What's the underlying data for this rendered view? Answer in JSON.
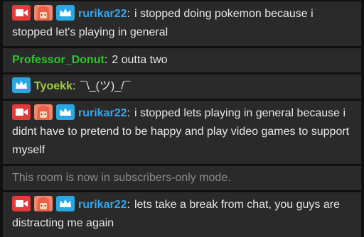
{
  "colors": {
    "background": "#111111",
    "message_bg": "#2a2a2a",
    "text": "#e6e6e6",
    "system_text": "#8a8a8a",
    "badge_red": "#e23b3b",
    "badge_orange": "#f0866c",
    "badge_blue": "#2aa7e3"
  },
  "messages": [
    {
      "badges": [
        "video-camera-icon",
        "sticker-face-icon",
        "crown-icon"
      ],
      "username": "rurikar22",
      "username_color": "#36a6f0",
      "separator": ":",
      "text": "i stopped doing pokemon because i stopped let's playing in general"
    },
    {
      "badges": [],
      "username": "Professor_Donut",
      "username_color": "#2ec72e",
      "separator": ":",
      "text": "2 outta two"
    },
    {
      "badges": [
        "crown-icon"
      ],
      "username": "Tyoekk",
      "username_color": "#9fcf3f",
      "separator": ":",
      "text": "¯\\_(ツ)_/¯"
    },
    {
      "badges": [
        "video-camera-icon",
        "sticker-face-icon",
        "crown-icon"
      ],
      "username": "rurikar22",
      "username_color": "#36a6f0",
      "separator": ":",
      "text": "i stopped lets playing in general because i didnt have to pretend to be happy and play video games to support myself"
    },
    {
      "system": true,
      "text": "This room is now in subscribers-only mode."
    },
    {
      "badges": [
        "video-camera-icon",
        "sticker-face-icon",
        "crown-icon"
      ],
      "username": "rurikar22",
      "username_color": "#36a6f0",
      "separator": ":",
      "text": "lets take a break from chat, you guys are distracting me again"
    }
  ]
}
